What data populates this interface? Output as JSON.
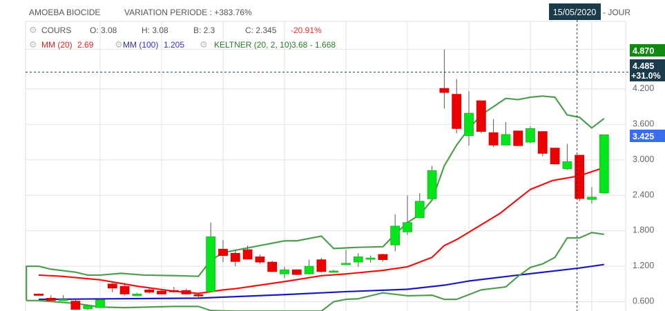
{
  "header": {
    "name": "AMOEBA BIOCIDE",
    "variation": "VARIATION PERIODE : +383.76%",
    "date": "15/05/2020",
    "period": "- JOUR"
  },
  "legend": {
    "cours_label": "COURS",
    "open": "O: 3.08",
    "high": "H: 3.08",
    "low": "B: 2.3",
    "close": "C: 2.345",
    "change": "-20.91%",
    "mm20_label": "MM (20)",
    "mm20_value": "2.69",
    "mm100_label": "MM (100)",
    "mm100_value": "1.205",
    "keltner_label": "KELTNER (20, 2, 10)",
    "keltner_value": "3.68 - 1.668"
  },
  "price_tags": {
    "high": "4.870",
    "cursor_price": "4.485",
    "cursor_change": "+31.0%",
    "last": "3.425"
  },
  "colors": {
    "up": "#00e61a",
    "down": "#ee0000",
    "mm20": "#ee1111",
    "mm100": "#1a1ab8",
    "keltner": "#4d9e4d",
    "tag_dark": "#1b3a4b",
    "tag_green": "#118a11",
    "tag_blue": "#3a6cf0"
  },
  "chart_data": {
    "type": "candlestick",
    "title": "AMOEBA BIOCIDE",
    "ylim": [
      0.6,
      4.87
    ],
    "yticks": [
      "4.200",
      "3.600",
      "3.000",
      "2.400",
      "1.800",
      "1.200",
      "0.600"
    ],
    "ytick_values": [
      4.2,
      3.6,
      3.0,
      2.4,
      1.8,
      1.2,
      0.6
    ],
    "cursor_value": 4.485,
    "cursor_index": 43.8,
    "candles_ohlc": [
      [
        0.73,
        0.74,
        0.7,
        0.71
      ],
      [
        0.66,
        0.71,
        0.62,
        0.62
      ],
      [
        0.64,
        0.71,
        0.63,
        0.64
      ],
      [
        0.61,
        0.63,
        0.46,
        0.47
      ],
      [
        0.48,
        0.53,
        0.46,
        0.53
      ],
      [
        0.5,
        0.66,
        0.5,
        0.63
      ],
      [
        0.9,
        0.94,
        0.76,
        0.83
      ],
      [
        0.86,
        0.92,
        0.71,
        0.73
      ],
      [
        0.7,
        0.75,
        0.7,
        0.73
      ],
      [
        0.8,
        0.82,
        0.74,
        0.76
      ],
      [
        0.78,
        0.8,
        0.72,
        0.73
      ],
      [
        0.79,
        0.85,
        0.75,
        0.77
      ],
      [
        0.79,
        0.82,
        0.72,
        0.73
      ],
      [
        0.72,
        0.73,
        0.66,
        0.71
      ],
      [
        0.77,
        1.94,
        0.77,
        1.7
      ],
      [
        1.49,
        1.64,
        1.27,
        1.38
      ],
      [
        1.42,
        1.48,
        1.2,
        1.28
      ],
      [
        1.48,
        1.55,
        1.32,
        1.32
      ],
      [
        1.36,
        1.4,
        1.24,
        1.27
      ],
      [
        1.27,
        1.29,
        1.1,
        1.11
      ],
      [
        1.07,
        1.19,
        1.0,
        1.14
      ],
      [
        1.14,
        1.15,
        1.05,
        1.06
      ],
      [
        1.07,
        1.31,
        1.06,
        1.2
      ],
      [
        1.31,
        1.34,
        1.09,
        1.11
      ],
      [
        1.1,
        1.14,
        1.09,
        1.12
      ],
      [
        1.25,
        1.48,
        1.23,
        1.25
      ],
      [
        1.27,
        1.42,
        1.19,
        1.36
      ],
      [
        1.33,
        1.38,
        1.26,
        1.34
      ],
      [
        1.4,
        1.41,
        1.28,
        1.31
      ],
      [
        1.56,
        2.08,
        1.45,
        1.88
      ],
      [
        1.78,
        2.4,
        1.73,
        1.94
      ],
      [
        2.02,
        2.44,
        2.02,
        2.3
      ],
      [
        2.34,
        2.9,
        2.34,
        2.82
      ],
      [
        4.21,
        4.87,
        3.87,
        4.14
      ],
      [
        4.11,
        4.37,
        3.45,
        3.53
      ],
      [
        3.41,
        4.16,
        3.24,
        3.79
      ],
      [
        4.0,
        4.0,
        3.45,
        3.48
      ],
      [
        3.46,
        3.69,
        3.22,
        3.25
      ],
      [
        3.25,
        3.64,
        3.25,
        3.43
      ],
      [
        3.49,
        3.49,
        3.24,
        3.24
      ],
      [
        3.3,
        3.57,
        3.28,
        3.53
      ],
      [
        3.48,
        3.48,
        3.06,
        3.11
      ],
      [
        3.2,
        3.2,
        2.93,
        2.93
      ],
      [
        2.85,
        3.27,
        2.83,
        2.97
      ],
      [
        3.08,
        3.08,
        2.3,
        2.345
      ],
      [
        2.33,
        2.54,
        2.26,
        2.37
      ],
      [
        2.44,
        3.43,
        2.43,
        3.425
      ]
    ],
    "series": [
      {
        "name": "MM (20)",
        "points": [
          [
            0,
            1.05
          ],
          [
            1.9,
            1.03
          ],
          [
            5,
            0.97
          ],
          [
            8.1,
            0.86
          ],
          [
            10.9,
            0.78
          ],
          [
            13,
            0.74
          ],
          [
            14,
            0.77
          ],
          [
            15,
            0.8
          ],
          [
            16,
            0.82
          ],
          [
            18,
            0.88
          ],
          [
            20,
            0.94
          ],
          [
            23,
            1.04
          ],
          [
            25,
            1.07
          ],
          [
            28,
            1.13
          ],
          [
            30,
            1.19
          ],
          [
            32,
            1.35
          ],
          [
            33,
            1.55
          ],
          [
            34,
            1.65
          ],
          [
            37.5,
            2.09
          ],
          [
            40,
            2.5
          ],
          [
            41.8,
            2.65
          ],
          [
            44,
            2.73
          ],
          [
            46,
            2.87
          ]
        ]
      },
      {
        "name": "MM (100)",
        "points": [
          [
            0,
            0.64
          ],
          [
            13,
            0.66
          ],
          [
            20,
            0.72
          ],
          [
            25,
            0.77
          ],
          [
            30,
            0.81
          ],
          [
            33,
            0.88
          ],
          [
            35,
            0.95
          ],
          [
            39,
            1.05
          ],
          [
            44,
            1.17
          ],
          [
            46,
            1.23
          ]
        ]
      },
      {
        "name": "KELTNER upper",
        "points": [
          [
            -1,
            0.62
          ],
          [
            -1,
            1.2
          ],
          [
            0,
            1.2
          ],
          [
            1,
            1.15
          ],
          [
            3,
            1.1
          ],
          [
            4,
            1.05
          ],
          [
            5,
            1.05
          ],
          [
            6.7,
            1.08
          ],
          [
            8.6,
            1.05
          ],
          [
            11.3,
            1.04
          ],
          [
            13,
            1.03
          ],
          [
            14,
            1.3
          ],
          [
            15,
            1.43
          ],
          [
            16,
            1.47
          ],
          [
            20,
            1.63
          ],
          [
            21,
            1.63
          ],
          [
            23,
            1.71
          ],
          [
            24,
            1.5
          ],
          [
            26,
            1.52
          ],
          [
            28,
            1.53
          ],
          [
            29,
            1.74
          ],
          [
            30,
            1.94
          ],
          [
            31,
            2.07
          ],
          [
            32,
            2.32
          ],
          [
            33,
            2.9
          ],
          [
            34,
            3.25
          ],
          [
            35,
            3.53
          ],
          [
            36,
            3.76
          ],
          [
            38,
            4.04
          ],
          [
            39,
            4.02
          ],
          [
            40,
            4.06
          ],
          [
            41,
            4.08
          ],
          [
            42,
            4.06
          ],
          [
            43,
            3.76
          ],
          [
            44,
            3.72
          ],
          [
            45,
            3.54
          ],
          [
            46,
            3.7
          ]
        ]
      },
      {
        "name": "KELTNER lower",
        "points": [
          [
            -1,
            0.62
          ],
          [
            0,
            0.62
          ],
          [
            3,
            0.57
          ],
          [
            5,
            0.51
          ],
          [
            7,
            0.5
          ],
          [
            11,
            0.52
          ],
          [
            13,
            0.52
          ],
          [
            14,
            0.45
          ],
          [
            16,
            0.44
          ],
          [
            23,
            0.44
          ],
          [
            24,
            0.6
          ],
          [
            25,
            0.64
          ],
          [
            26,
            0.65
          ],
          [
            28,
            0.75
          ],
          [
            30,
            0.7
          ],
          [
            32,
            0.71
          ],
          [
            33,
            0.64
          ],
          [
            34,
            0.64
          ],
          [
            36,
            0.8
          ],
          [
            38,
            0.85
          ],
          [
            39,
            1.03
          ],
          [
            40,
            1.18
          ],
          [
            41,
            1.24
          ],
          [
            42,
            1.35
          ],
          [
            43,
            1.68
          ],
          [
            44,
            1.68
          ],
          [
            45,
            1.77
          ],
          [
            46,
            1.74
          ]
        ]
      }
    ]
  }
}
